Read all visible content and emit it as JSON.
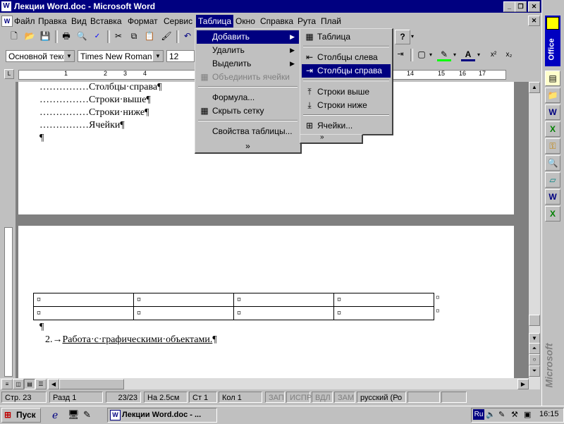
{
  "window": {
    "title": "Лекции Word.doc - Microsoft Word",
    "doc_icon": "W"
  },
  "menubar": [
    {
      "label": "Файл"
    },
    {
      "label": "Правка"
    },
    {
      "label": "Вид"
    },
    {
      "label": "Вставка"
    },
    {
      "label": "Формат"
    },
    {
      "label": "Сервис"
    },
    {
      "label": "Таблица"
    },
    {
      "label": "Окно"
    },
    {
      "label": "Справка"
    },
    {
      "label": "Рута"
    },
    {
      "label": "Плай"
    }
  ],
  "formatting": {
    "style": "Основной текст",
    "font": "Times New Roman",
    "size": "12"
  },
  "ruler_ticks": [
    "1",
    "2",
    "3",
    "4",
    "14",
    "15",
    "16",
    "17"
  ],
  "table_menu": {
    "items": [
      {
        "label": "Добавить",
        "has_sub": true
      },
      {
        "label": "Удалить",
        "has_sub": true
      },
      {
        "label": "Выделить",
        "has_sub": true
      },
      {
        "label": "Объединить ячейки"
      },
      {
        "label": "Формула..."
      },
      {
        "label": "Скрыть сетку"
      },
      {
        "label": "Свойства таблицы..."
      }
    ],
    "more": "»"
  },
  "insert_submenu": {
    "items": [
      {
        "label": "Таблица"
      },
      {
        "label": "Столбцы слева"
      },
      {
        "label": "Столбцы справа"
      },
      {
        "label": "Строки выше"
      },
      {
        "label": "Строки ниже"
      },
      {
        "label": "Ячейки..."
      }
    ]
  },
  "page1_lines": [
    "Столбцы·справа¶",
    "Строки·выше¶",
    "Строки·ниже¶",
    "Ячейки¶",
    "¶"
  ],
  "page2": {
    "table_cells": [
      [
        "¤",
        "¤",
        "¤",
        "¤"
      ],
      [
        "¤",
        "¤",
        "¤",
        "¤"
      ]
    ],
    "row_end": "¤",
    "para": "¶",
    "heading_num": "2.→",
    "heading_text": "Работа·с·графическими·объектами.",
    "heading_end": "¶"
  },
  "statusbar": {
    "page": "Стр. 23",
    "section": "Разд 1",
    "pages": "23/23",
    "at": "На 2.5см",
    "line": "Ст 1",
    "col": "Кол 1",
    "rec": "ЗАП",
    "trk": "ИСПР",
    "ext": "ВДЛ",
    "ovr": "ЗАМ",
    "lang": "русский (Ро"
  },
  "taskbar": {
    "start": "Пуск",
    "task": "Лекции Word.doc - ...",
    "lang": "Ru",
    "clock": "16:15"
  },
  "office_bar": {
    "label": "Office",
    "brand": "Microsoft"
  }
}
